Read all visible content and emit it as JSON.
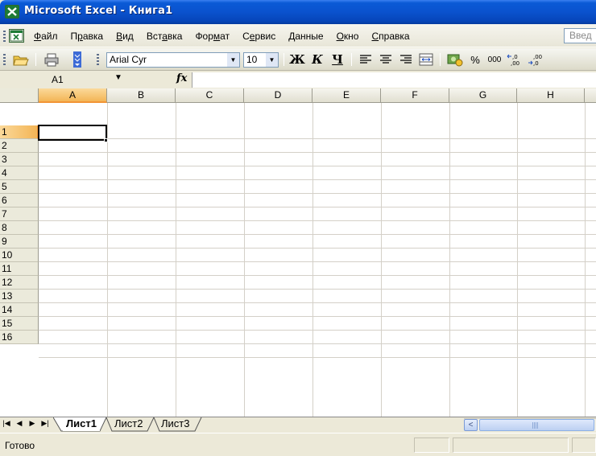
{
  "window": {
    "title": "Microsoft Excel - Книга1"
  },
  "menu": {
    "items": [
      {
        "key": "file",
        "label": "Файл"
      },
      {
        "key": "edit",
        "label": "Правка"
      },
      {
        "key": "view",
        "label": "Вид"
      },
      {
        "key": "insert",
        "label": "Вставка"
      },
      {
        "key": "format",
        "label": "Формат"
      },
      {
        "key": "tools",
        "label": "Сервис"
      },
      {
        "key": "data",
        "label": "Данные"
      },
      {
        "key": "window",
        "label": "Окно"
      },
      {
        "key": "help",
        "label": "Справка"
      }
    ],
    "help_box": "Введ"
  },
  "toolbar": {
    "font_name": "Arial Cyr",
    "font_size": "10",
    "bold_label": "Ж",
    "italic_label": "К",
    "underline_label": "Ч",
    "percent_label": "%",
    "thousands_label": "000",
    "icons": [
      "open-icon",
      "print-icon",
      "toolbar-options-icon",
      "align-left-icon",
      "align-center-icon",
      "align-right-icon",
      "merge-center-icon",
      "currency-icon",
      "increase-decimal-icon",
      "decrease-decimal-icon"
    ]
  },
  "formula_bar": {
    "name_box": "A1",
    "fx_label": "fx",
    "value": ""
  },
  "grid": {
    "columns": [
      "A",
      "B",
      "C",
      "D",
      "E",
      "F",
      "G",
      "H"
    ],
    "rows": [
      "1",
      "2",
      "3",
      "4",
      "5",
      "6",
      "7",
      "8",
      "9",
      "10",
      "11",
      "12",
      "13",
      "14",
      "15",
      "16"
    ],
    "active_cell": "A1"
  },
  "sheets": {
    "tabs": [
      "Лист1",
      "Лист2",
      "Лист3"
    ],
    "active": "Лист1"
  },
  "status": {
    "text": "Готово"
  },
  "colors": {
    "title_bar": "#0a52ce",
    "active_header": "#f3b556",
    "gridline": "#d4d0c8"
  }
}
